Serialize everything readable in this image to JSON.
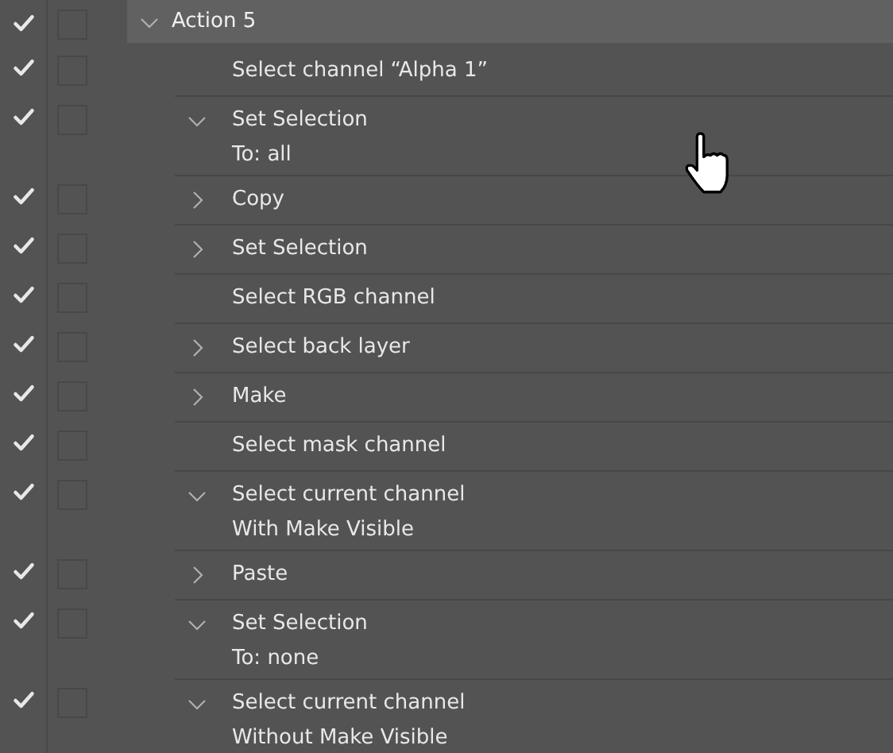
{
  "action": {
    "name": "Action 5",
    "enabled": true,
    "expanded": true,
    "selected": true
  },
  "steps": [
    {
      "label": "Select channel “Alpha 1”",
      "enabled": true
    },
    {
      "label": "Set Selection",
      "enabled": true,
      "expanded": true,
      "details": [
        "To: all"
      ]
    },
    {
      "label": "Copy",
      "enabled": true,
      "expanded": false
    },
    {
      "label": "Set Selection",
      "enabled": true,
      "expanded": false
    },
    {
      "label": "Select RGB channel",
      "enabled": true
    },
    {
      "label": "Select back layer",
      "enabled": true,
      "expanded": false
    },
    {
      "label": "Make",
      "enabled": true,
      "expanded": false
    },
    {
      "label": "Select mask channel",
      "enabled": true
    },
    {
      "label": "Select current channel",
      "enabled": true,
      "expanded": true,
      "details": [
        "With Make Visible"
      ]
    },
    {
      "label": "Paste",
      "enabled": true,
      "expanded": false
    },
    {
      "label": "Set Selection",
      "enabled": true,
      "expanded": true,
      "details": [
        "To: none"
      ]
    },
    {
      "label": "Select current channel",
      "enabled": true,
      "expanded": true,
      "details": [
        "Without Make Visible"
      ]
    }
  ]
}
